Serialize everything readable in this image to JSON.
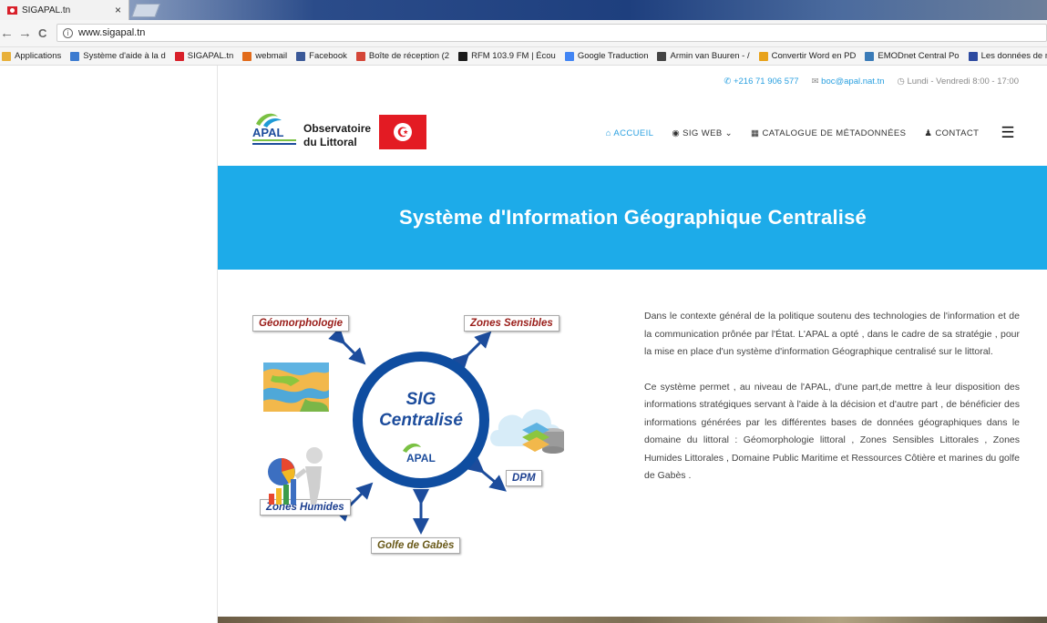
{
  "browser": {
    "tab_title": "SIGAPAL.tn",
    "tab_close": "×",
    "back": "←",
    "forward": "→",
    "reload": "C",
    "info": "i",
    "url": "www.sigapal.tn",
    "bookmarks": [
      {
        "label": "Applications",
        "color": "#e8b03a"
      },
      {
        "label": "Système d'aide à la d",
        "color": "#3c7bd0"
      },
      {
        "label": "SIGAPAL.tn",
        "color": "#d8202a"
      },
      {
        "label": "webmail",
        "color": "#e26b1a"
      },
      {
        "label": "Facebook",
        "color": "#3b5998"
      },
      {
        "label": "Boîte de réception (2",
        "color": "#d44638"
      },
      {
        "label": "RFM 103.9 FM | Écou",
        "color": "#1b1b1b"
      },
      {
        "label": "Google Traduction",
        "color": "#4285f4"
      },
      {
        "label": "Armin van Buuren - /",
        "color": "#444444"
      },
      {
        "label": "Convertir Word en PD",
        "color": "#e8a21a"
      },
      {
        "label": "EMODnet Central Po",
        "color": "#3a7bb8"
      },
      {
        "label": "Les données de mes",
        "color": "#2d4aa0"
      }
    ]
  },
  "site": {
    "topbar": {
      "phone": "+216 71 906 577",
      "email": "boc@apal.nat.tn",
      "hours": "Lundi - Vendredi 8:00 - 17:00"
    },
    "logo": {
      "apal": "APAL",
      "line1": "Observatoire",
      "line2": "du Littoral"
    },
    "menu": {
      "home": "ACCUEIL",
      "sig_web": "SIG WEB",
      "catalogue": "CATALOGUE DE MÉTADONNÉES",
      "contact": "CONTACT"
    },
    "banner_title": "Système d'Information Géographique Centralisé",
    "diagram": {
      "center_line1": "SIG",
      "center_line2": "Centralisé",
      "center_logo": "APAL",
      "geomorphologie": "Géomorphologie",
      "zones_sensibles": "Zones Sensibles",
      "dpm": "DPM",
      "zones_humides": "Zones Humides",
      "golfe": "Golfe de Gabès"
    },
    "paragraphs": [
      "Dans le contexte général de la politique soutenu des technologies de l'information et de la communication prônée par l'État. L'APAL a opté , dans le cadre de sa stratégie , pour la mise en place d'un système d'information Géographique centralisé sur le littoral.",
      "Ce système permet , au niveau de l'APAL, d'une part,de mettre à leur disposition des informations stratégiques servant à l'aide à la décision et d'autre part , de bénéficier des informations générées par les différentes bases de données géographiques dans le domaine du littoral : Géomorphologie littoral , Zones Sensibles Littorales , Zones Humides Littorales , Domaine Public Maritime et Ressources Côtière et marines du golfe de Gabès ."
    ]
  },
  "colors": {
    "banner": "#1dabe9",
    "accent": "#2aa0e0",
    "ring": "#0f4da0"
  }
}
